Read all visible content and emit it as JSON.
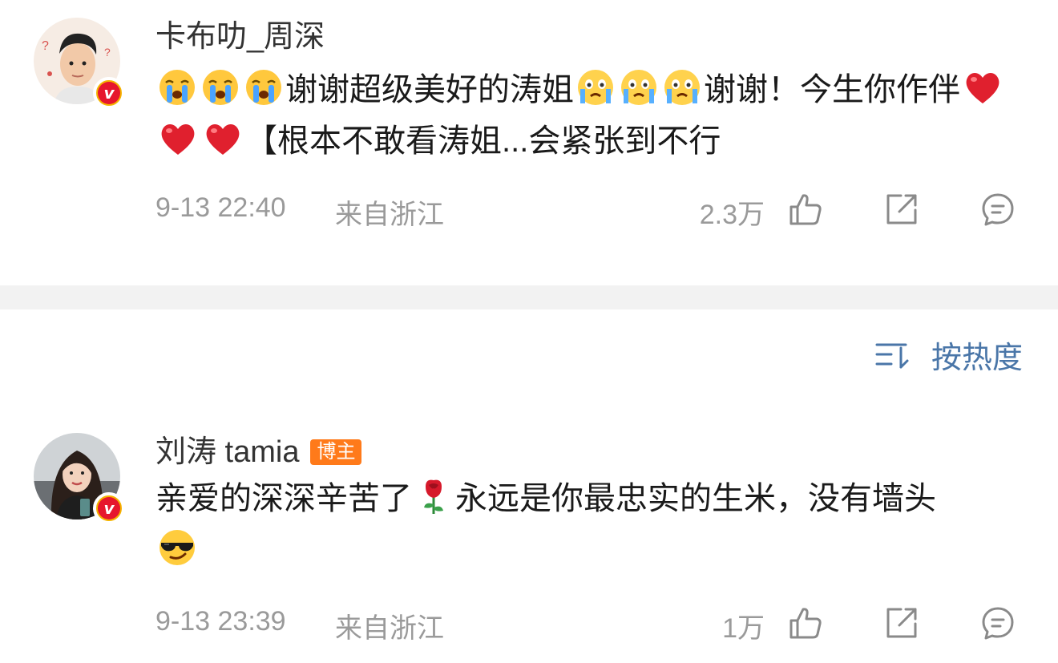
{
  "posts": [
    {
      "username": "卡布叻_周深",
      "content": {
        "part1": "谢谢超级美好的涛姐",
        "part2": "谢谢！今生你作伴",
        "part3": "【根本不敢看涛姐...会紧张到不行"
      },
      "emojis": [
        "crying-emoji",
        "crying-emoji",
        "crying-emoji",
        "tears-emoji",
        "tears-emoji",
        "tears-emoji",
        "red-heart-emoji",
        "red-heart-emoji",
        "red-heart-emoji"
      ],
      "time": "9-13 22:40",
      "location": "来自浙江",
      "likes": "2.3万"
    },
    {
      "username": "刘涛 tamia",
      "tag": "博主",
      "content": {
        "part1": "亲爱的深深辛苦了",
        "part2": "永远是你最忠实的生米，没有墙头"
      },
      "emojis": [
        "rose-emoji",
        "sunglasses-emoji"
      ],
      "time": "9-13 23:39",
      "location": "来自浙江",
      "likes": "1万"
    }
  ],
  "sort": {
    "label": "按热度",
    "icon": "sort-icon"
  },
  "colors": {
    "accent_blue": "#4a76a8",
    "tag_orange": "#ff7a1a",
    "meta_gray": "#9a9a9a",
    "divider": "#f2f2f2",
    "verified_red": "#e6162d",
    "verified_gold": "#f5b400"
  }
}
